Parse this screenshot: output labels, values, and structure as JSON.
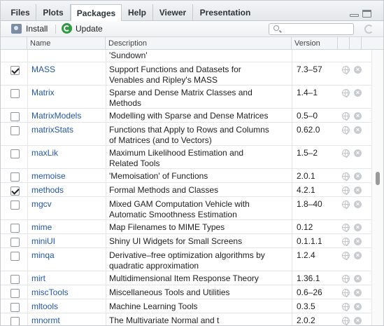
{
  "tabs": [
    {
      "label": "Files"
    },
    {
      "label": "Plots"
    },
    {
      "label": "Packages"
    },
    {
      "label": "Help"
    },
    {
      "label": "Viewer"
    },
    {
      "label": "Presentation"
    }
  ],
  "toolbar": {
    "install_label": "Install",
    "update_label": "Update",
    "search_placeholder": ""
  },
  "columns": {
    "name": "Name",
    "description": "Description",
    "version": "Version"
  },
  "rows": [
    {
      "checked": null,
      "name": "",
      "desc1": "'Sundown'",
      "desc2": "",
      "version": ""
    },
    {
      "checked": true,
      "name": "MASS",
      "desc1": "Support Functions and Datasets for",
      "desc2": "Venables and Ripley's MASS",
      "version": "7.3–57"
    },
    {
      "checked": false,
      "name": "Matrix",
      "desc1": "Sparse and Dense Matrix Classes and",
      "desc2": "Methods",
      "version": "1.4–1"
    },
    {
      "checked": false,
      "name": "MatrixModels",
      "desc1": "Modelling with Sparse and Dense Matrices",
      "desc2": "",
      "version": "0.5–0"
    },
    {
      "checked": false,
      "name": "matrixStats",
      "desc1": "Functions that Apply to Rows and Columns",
      "desc2": "of Matrices (and to Vectors)",
      "version": "0.62.0"
    },
    {
      "checked": false,
      "name": "maxLik",
      "desc1": "Maximum Likelihood Estimation and",
      "desc2": "Related Tools",
      "version": "1.5–2"
    },
    {
      "checked": false,
      "name": "memoise",
      "desc1": "'Memoisation' of Functions",
      "desc2": "",
      "version": "2.0.1"
    },
    {
      "checked": true,
      "name": "methods",
      "desc1": "Formal Methods and Classes",
      "desc2": "",
      "version": "4.2.1"
    },
    {
      "checked": false,
      "name": "mgcv",
      "desc1": "Mixed GAM Computation Vehicle with",
      "desc2": "Automatic Smoothness Estimation",
      "version": "1.8–40"
    },
    {
      "checked": false,
      "name": "mime",
      "desc1": "Map Filenames to MIME Types",
      "desc2": "",
      "version": "0.12"
    },
    {
      "checked": false,
      "name": "miniUI",
      "desc1": "Shiny UI Widgets for Small Screens",
      "desc2": "",
      "version": "0.1.1.1"
    },
    {
      "checked": false,
      "name": "minqa",
      "desc1": "Derivative–free optimization algorithms by",
      "desc2": "quadratic approximation",
      "version": "1.2.4"
    },
    {
      "checked": false,
      "name": "mirt",
      "desc1": "Multidimensional Item Response Theory",
      "desc2": "",
      "version": "1.36.1"
    },
    {
      "checked": false,
      "name": "miscTools",
      "desc1": "Miscellaneous Tools and Utilities",
      "desc2": "",
      "version": "0.6–26"
    },
    {
      "checked": false,
      "name": "mltools",
      "desc1": "Machine Learning Tools",
      "desc2": "",
      "version": "0.3.5"
    },
    {
      "checked": false,
      "name": "mnormt",
      "desc1": "The Multivariate Normal and t",
      "desc2": "",
      "version": "2.0.2"
    }
  ]
}
